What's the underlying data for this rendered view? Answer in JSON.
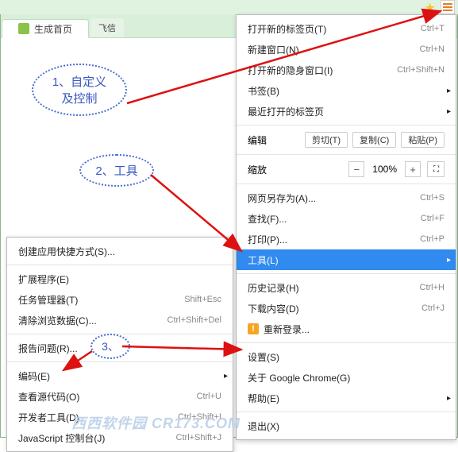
{
  "toolbar": {
    "star_title": "star-icon",
    "menu_title": "menu-icon"
  },
  "tabs": {
    "active_label": "生成首页",
    "fx_label": "飞信"
  },
  "callouts": {
    "c1_line1": "1、自定义",
    "c1_line2": "及控制",
    "c2": "2、工具",
    "c3": "3、"
  },
  "mainmenu": {
    "new_tab": "打开新的标签页(T)",
    "new_tab_sc": "Ctrl+T",
    "new_window": "新建窗口(N)",
    "new_window_sc": "Ctrl+N",
    "incognito": "打开新的隐身窗口(I)",
    "incognito_sc": "Ctrl+Shift+N",
    "bookmarks": "书签(B)",
    "recent": "最近打开的标签页",
    "edit": "编辑",
    "cut": "剪切(T)",
    "copy": "复制(C)",
    "paste": "粘贴(P)",
    "zoom": "缩放",
    "zoom_val": "100%",
    "saveas": "网页另存为(A)...",
    "saveas_sc": "Ctrl+S",
    "find": "查找(F)...",
    "find_sc": "Ctrl+F",
    "print": "打印(P)...",
    "print_sc": "Ctrl+P",
    "tools": "工具(L)",
    "history": "历史记录(H)",
    "history_sc": "Ctrl+H",
    "downloads": "下载内容(D)",
    "downloads_sc": "Ctrl+J",
    "signin": "重新登录...",
    "settings": "设置(S)",
    "about": "关于 Google Chrome(G)",
    "help": "帮助(E)",
    "exit": "退出(X)"
  },
  "submenu": {
    "create_shortcut": "创建应用快捷方式(S)...",
    "extensions": "扩展程序(E)",
    "taskmgr": "任务管理器(T)",
    "taskmgr_sc": "Shift+Esc",
    "clear": "清除浏览数据(C)...",
    "clear_sc": "Ctrl+Shift+Del",
    "report": "报告问题(R)...",
    "encoding": "编码(E)",
    "viewsrc": "查看源代码(O)",
    "viewsrc_sc": "Ctrl+U",
    "devtools": "开发者工具(D)",
    "devtools_sc": "Ctrl+Shift+I",
    "jsconsole": "JavaScript 控制台(J)",
    "jsconsole_sc": "Ctrl+Shift+J"
  },
  "watermark": "西西软件园 CR173.COM"
}
